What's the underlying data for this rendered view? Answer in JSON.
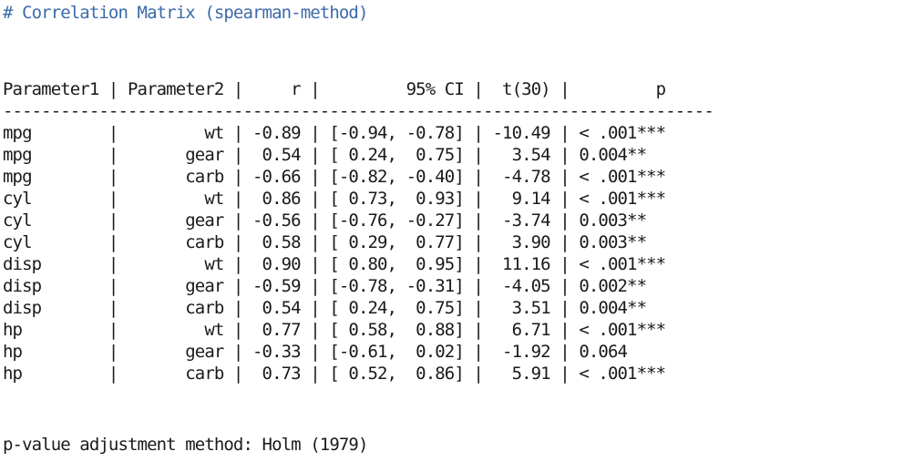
{
  "title": "# Correlation Matrix (spearman-method)",
  "table": {
    "header": "Parameter1 | Parameter2 |     r |         95% CI |  t(30) |         p",
    "rule": "--------------------------------------------------------------------------",
    "rows": [
      "mpg        |         wt | -0.89 | [-0.94, -0.78] | -10.49 | < .001***",
      "mpg        |       gear |  0.54 | [ 0.24,  0.75] |   3.54 | 0.004**  ",
      "mpg        |       carb | -0.66 | [-0.82, -0.40] |  -4.78 | < .001***",
      "cyl        |         wt |  0.86 | [ 0.73,  0.93] |   9.14 | < .001***",
      "cyl        |       gear | -0.56 | [-0.76, -0.27] |  -3.74 | 0.003**  ",
      "cyl        |       carb |  0.58 | [ 0.29,  0.77] |   3.90 | 0.003**  ",
      "disp       |         wt |  0.90 | [ 0.80,  0.95] |  11.16 | < .001***",
      "disp       |       gear | -0.59 | [-0.78, -0.31] |  -4.05 | 0.002**  ",
      "disp       |       carb |  0.54 | [ 0.24,  0.75] |   3.51 | 0.004**  ",
      "hp         |         wt |  0.77 | [ 0.58,  0.88] |   6.71 | < .001***",
      "hp         |       gear | -0.33 | [-0.61,  0.02] |  -1.92 | 0.064    ",
      "hp         |       carb |  0.73 | [ 0.52,  0.86] |   5.91 | < .001***"
    ]
  },
  "footer": "p-value adjustment method: Holm (1979)"
}
